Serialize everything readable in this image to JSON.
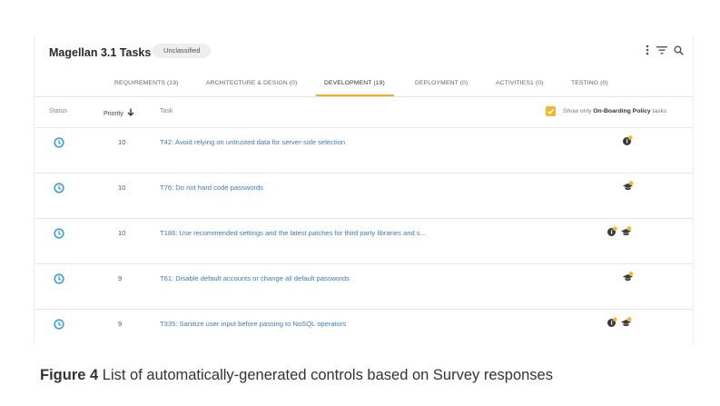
{
  "header": {
    "title": "Magellan 3.1 Tasks",
    "badge": "Unclassified"
  },
  "tabs": [
    {
      "label": "REQUIREMENTS (19)",
      "active": false
    },
    {
      "label": "ARCHITECTURE & DESIGN (0)",
      "active": false
    },
    {
      "label": "DEVELOPMENT (19)",
      "active": true
    },
    {
      "label": "DEPLOYMENT (0)",
      "active": false
    },
    {
      "label": "ACTIVITIES1 (0)",
      "active": false
    },
    {
      "label": "TESTING (0)",
      "active": false
    }
  ],
  "columns": {
    "status": "Status",
    "priority": "Priority",
    "task": "Task"
  },
  "filter": {
    "checked": true,
    "label_prefix": "Show only",
    "label_bold": "On-Boarding Policy",
    "label_suffix": "tasks"
  },
  "rows": [
    {
      "priority": "10",
      "task": "T42: Avoid relying on untrusted data for server-side selection",
      "icons": [
        "info-badge-icon"
      ]
    },
    {
      "priority": "10",
      "task": "T76: Do not hard code passwords",
      "icons": [
        "grad-cap-icon"
      ]
    },
    {
      "priority": "10",
      "task": "T186: Use recommended settings and the latest patches for third party libraries and s...",
      "icons": [
        "info-badge-icon",
        "grad-cap-icon"
      ]
    },
    {
      "priority": "9",
      "task": "T61: Disable default accounts or change all default passwords",
      "icons": [
        "grad-cap-icon"
      ]
    },
    {
      "priority": "9",
      "task": "T335: Sanitize user input before passing to NoSQL operators",
      "icons": [
        "info-badge-icon",
        "grad-cap-icon"
      ]
    }
  ],
  "caption": {
    "label": "Figure 4",
    "text": "List of automatically-generated controls based on Survey responses"
  },
  "colors": {
    "accent": "#f0ae28",
    "link": "#3d7bbf",
    "status": "#3aa0d8"
  }
}
